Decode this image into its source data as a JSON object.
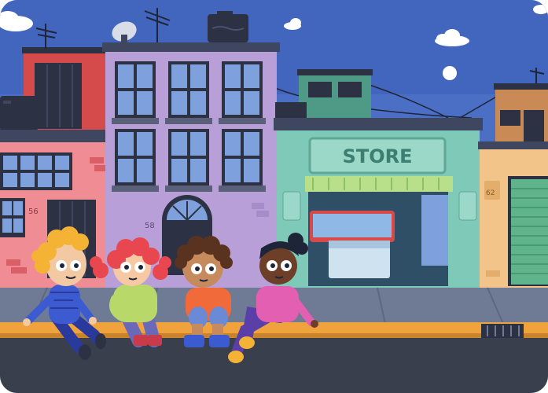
{
  "scene": {
    "store_sign": "STORE",
    "house_numbers": [
      "56",
      "58",
      "62"
    ],
    "colors": {
      "sky": "#4a6fc4",
      "sky_top": "#3a5cb5",
      "sidewalk": "#6f7a95",
      "curb": "#f0a23c",
      "road": "#3a3f4d",
      "store_green": "#7fc9b8",
      "purple_building": "#b89fd8",
      "pink_building": "#f08c93",
      "red_building": "#d54b4b"
    },
    "icons": [
      "satellite-dish-icon",
      "tv-antenna-icon",
      "sun-icon",
      "cloud-icon",
      "drain-grate-icon"
    ]
  },
  "characters": [
    {
      "name": "kid-blonde",
      "shirt": "#3d5bd1"
    },
    {
      "name": "kid-redhead",
      "shirt": "#b8d86a"
    },
    {
      "name": "kid-curly",
      "shirt": "#f06a3a"
    },
    {
      "name": "kid-pink",
      "shirt": "#e35fb2"
    }
  ]
}
